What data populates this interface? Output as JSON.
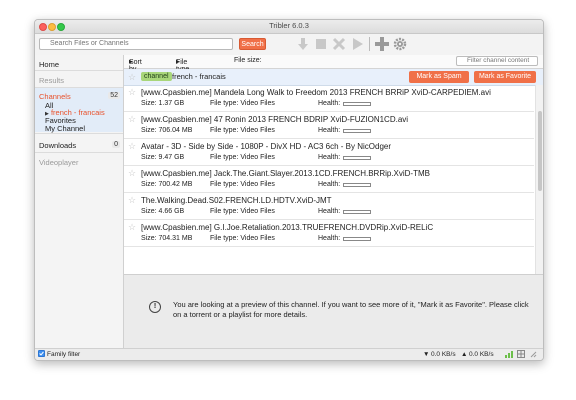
{
  "window": {
    "title": "Tribler 6.0.3"
  },
  "toolbar": {
    "search_placeholder": "Search Files or Channels",
    "search_button": "Search",
    "icons": [
      "download-icon",
      "stop-icon",
      "delete-icon",
      "play-icon",
      "add-icon",
      "settings-icon"
    ]
  },
  "sidebar": {
    "home": "Home",
    "results": "Results",
    "channels": "Channels",
    "channels_count": "52",
    "all": "All",
    "french": "french - francais",
    "favorites": "Favorites",
    "my_channel": "My Channel",
    "downloads": "Downloads",
    "downloads_count": "0",
    "videoplayer": "Videoplayer"
  },
  "sortbar": {
    "sort_by": "Sort by",
    "file_type": "File type",
    "file_size": "File size:",
    "filter_placeholder": "Filter channel content"
  },
  "channel": {
    "tag": "channel",
    "name": "french - francais",
    "spam_button": "Mark as Spam",
    "favorite_button": "Mark as Favorite"
  },
  "torrents": [
    {
      "name": "[www.Cpasbien.me] Mandela Long Walk to Freedom 2013 FRENCH BRRiP XviD-CARPEDIEM.avi",
      "size": "Size: 1.37 GB",
      "type": "File type: Video Files",
      "health": "Health:"
    },
    {
      "name": "[www.Cpasbien.me] 47 Ronin 2013 FRENCH BDRIP XviD-FUZION1CD.avi",
      "size": "Size: 706.04 MB",
      "type": "File type: Video Files",
      "health": "Health:"
    },
    {
      "name": "Avatar - 3D - Side by Side - 1080P - DivX HD - AC3 6ch - By NicOdger",
      "size": "Size: 9.47 GB",
      "type": "File type: Video Files",
      "health": "Health:"
    },
    {
      "name": "[www.Cpasbien.me] Jack.The.Giant.Slayer.2013.1CD.FRENCH.BRRip.XviD-TMB",
      "size": "Size: 700.42 MB",
      "type": "File type: Video Files",
      "health": "Health:"
    },
    {
      "name": "The.Walking.Dead.S02.FRENCH.LD.HDTV.XviD-JMT",
      "size": "Size: 4.66 GB",
      "type": "File type: Video Files",
      "health": "Health:"
    },
    {
      "name": "[www.Cpasbien.me] G.I.Joe.Retaliation.2013.TRUEFRENCH.DVDRip.XviD-RELiC",
      "size": "Size: 704.31 MB",
      "type": "File type: Video Files",
      "health": "Health:"
    }
  ],
  "preview": {
    "text": "You are looking at a preview of this channel. If you want to see more of it, \"Mark it as Favorite\". Please click on a torrent or a playlist for more details."
  },
  "status": {
    "family_filter": "Family filter",
    "down_rate": "0.0 KB/s",
    "up_rate": "0.0 KB/s"
  }
}
